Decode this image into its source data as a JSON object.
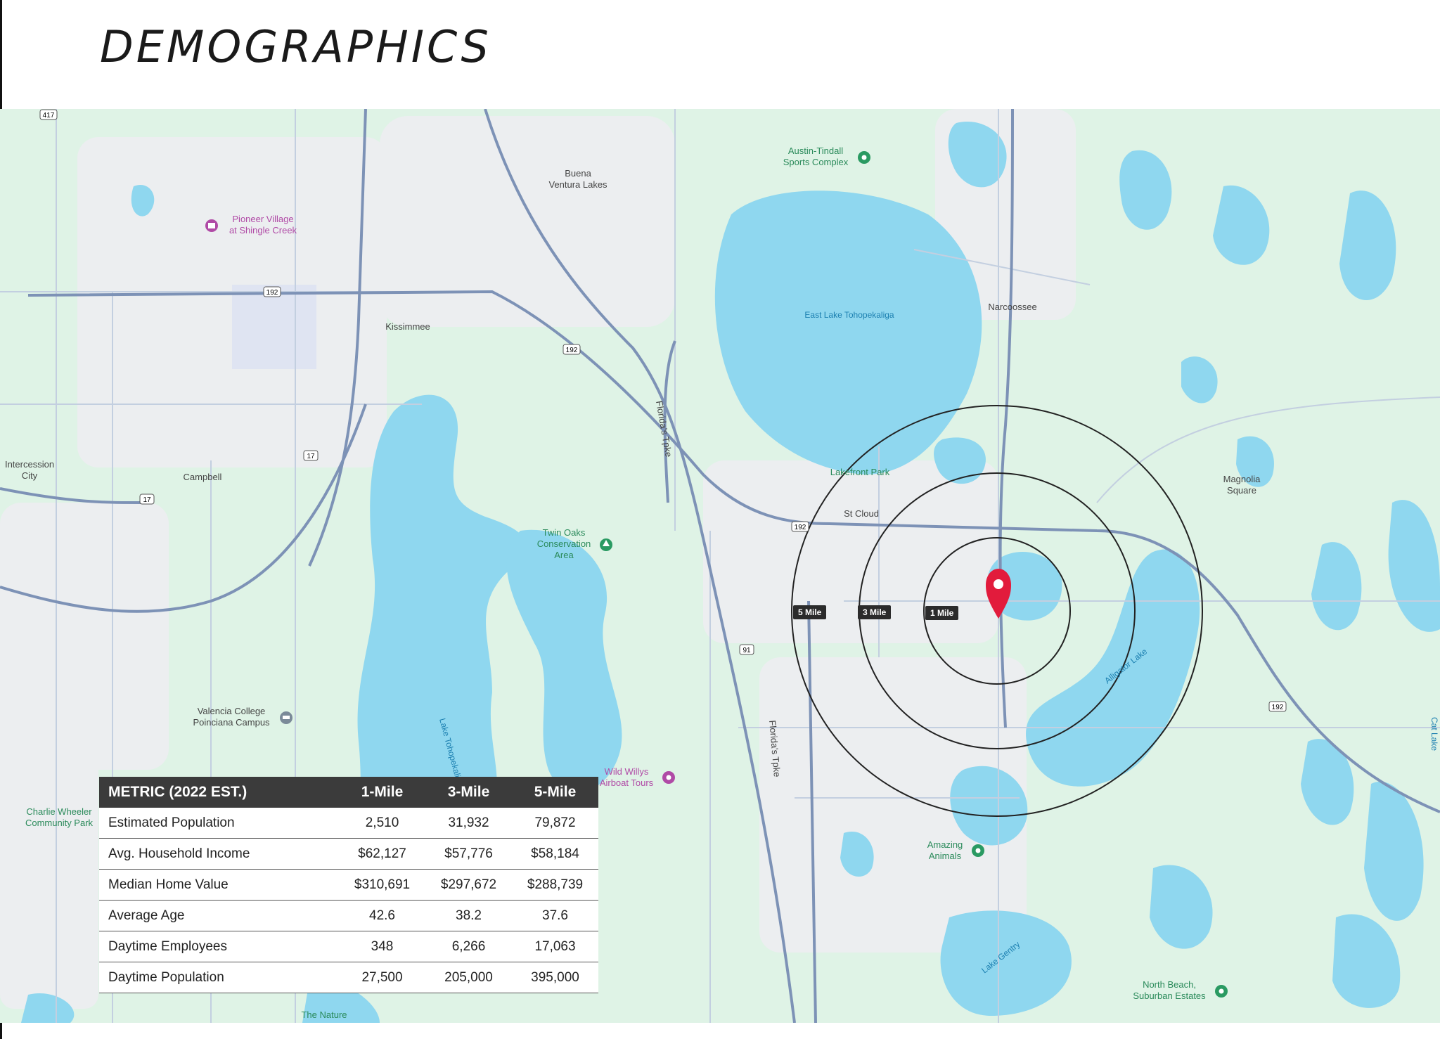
{
  "page": {
    "title": "DEMOGRAPHICS"
  },
  "map": {
    "place_labels": [
      {
        "key": "buena1",
        "text": "Buena"
      },
      {
        "key": "buena2",
        "text": "Ventura Lakes"
      },
      {
        "key": "kissimmee",
        "text": "Kissimmee"
      },
      {
        "key": "narcoossee",
        "text": "Narcoossee"
      },
      {
        "key": "intercession1",
        "text": "Intercession"
      },
      {
        "key": "intercession2",
        "text": "City"
      },
      {
        "key": "campbell",
        "text": "Campbell"
      },
      {
        "key": "stcloud",
        "text": "St Cloud"
      },
      {
        "key": "magnolia1",
        "text": "Magnolia"
      },
      {
        "key": "magnolia2",
        "text": "Square"
      },
      {
        "key": "lakefront",
        "text": "Lakefront Park"
      }
    ],
    "water_labels": {
      "east_lake": "East Lake Tohopekaliga",
      "lake_toho": "Lake Tohopekaliga",
      "alligator": "Alligator Lake",
      "gentry": "Lake Gentry",
      "cat": "Cat Lake"
    },
    "poi_labels": {
      "pioneer1": "Pioneer Village",
      "pioneer2": "at Shingle Creek",
      "austin1": "Austin-Tindall",
      "austin2": "Sports Complex",
      "twinoaks1": "Twin Oaks",
      "twinoaks2": "Conservation",
      "twinoaks3": "Area",
      "valencia1": "Valencia College",
      "valencia2": "Poinciana Campus",
      "willys1": "Wild Willys",
      "willys2": "Airboat Tours",
      "charlie1": "Charlie Wheeler",
      "charlie2": "Community Park",
      "amazing1": "Amazing",
      "amazing2": "Animals",
      "northbeach1": "North Beach,",
      "northbeach2": "Suburban Estates",
      "nature": "The Nature"
    },
    "highway_shields": {
      "s417": "417",
      "s192a": "192",
      "s192b": "192",
      "s192c": "192",
      "s192d": "192",
      "s17": "17",
      "s17b": "17",
      "s91": "91"
    },
    "road_labels": {
      "turnpike1": "Florida's Tpke",
      "turnpike2": "Florida's Tpke"
    },
    "radius_labels": {
      "five": "5 Mile",
      "three": "3 Mile",
      "one": "1 Mile"
    },
    "colors": {
      "water": "#8fd7ef",
      "land": "#dff3e6",
      "urban": "#eceef0",
      "road": "#aebfd6",
      "highway": "#6f86ad",
      "pin": "#e21b3c"
    },
    "icons": [
      "location-pin-icon",
      "museum-icon",
      "park-icon",
      "college-icon",
      "attraction-icon"
    ]
  },
  "table": {
    "headers": [
      "METRIC (2022 EST.)",
      "1-Mile",
      "3-Mile",
      "5-Mile"
    ],
    "rows": [
      [
        "Estimated Population",
        "2,510",
        "31,932",
        "79,872"
      ],
      [
        "Avg. Household Income",
        "$62,127",
        "$57,776",
        "$58,184"
      ],
      [
        "Median Home Value",
        "$310,691",
        "$297,672",
        "$288,739"
      ],
      [
        "Average Age",
        "42.6",
        "38.2",
        "37.6"
      ],
      [
        "Daytime Employees",
        "348",
        "6,266",
        "17,063"
      ],
      [
        "Daytime Population",
        "27,500",
        "205,000",
        "395,000"
      ]
    ]
  }
}
